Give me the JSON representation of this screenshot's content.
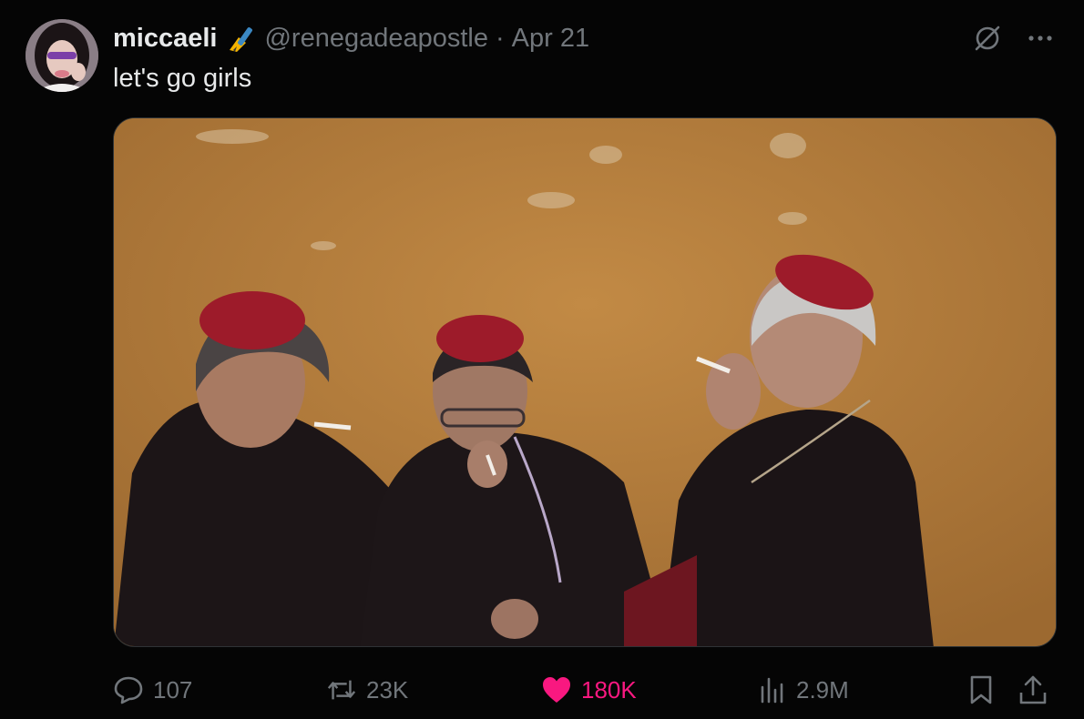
{
  "author": {
    "display_name": "miccaeli",
    "emoji_icon": "writing-hand-emoji",
    "handle": "@renegadeapostle",
    "separator": "·",
    "date": "Apr 21"
  },
  "tweet": {
    "text": "let's go girls"
  },
  "top_actions": {
    "grok_icon": "grok-icon",
    "more_icon": "more-dots-icon"
  },
  "media": {
    "kind": "photo",
    "content": "three cardinals in black cassocks and red zucchettos smoking cigarettes in front of an ochre wall"
  },
  "metrics": {
    "replies": "107",
    "reposts": "23K",
    "likes": "180K",
    "views": "2.9M"
  },
  "colors": {
    "background": "#050505",
    "text": "#e7e9ea",
    "muted": "#71767b",
    "like_active": "#f91880",
    "border": "#2f3336"
  }
}
